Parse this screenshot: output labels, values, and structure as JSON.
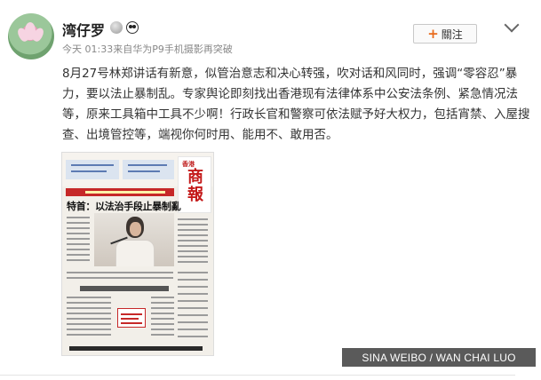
{
  "post": {
    "username": "湾仔罗",
    "meta": "今天 01:33来自华为P9手机摄影再突破",
    "body": "8月27号林郑讲话有新意，似管治意志和决心转强，吹对话和风同时，强调“零容忍”暴力，要以法止暴制乱。专家舆论即刻找出香港现有法律体系中公安法条例、紧急情况法等，原来工具箱中工具不少啊！行政长官和警察可依法赋予好大权力，包括宵禁、入屋搜查、出境管控等，端视你何时用、能用不、敢用否。"
  },
  "follow_button": {
    "plus": "+",
    "label": "關注"
  },
  "news_image": {
    "masthead_small": "香港",
    "masthead_big": "商報",
    "headline": "特首：以法治手段止暴制亂"
  },
  "credit": "SINA WEIBO / WAN CHAI LUO",
  "icons": {
    "avatar": "lotus-avatar",
    "badges": [
      "medal-icon",
      "panda-icon"
    ],
    "menu": "chevron-down-icon"
  }
}
